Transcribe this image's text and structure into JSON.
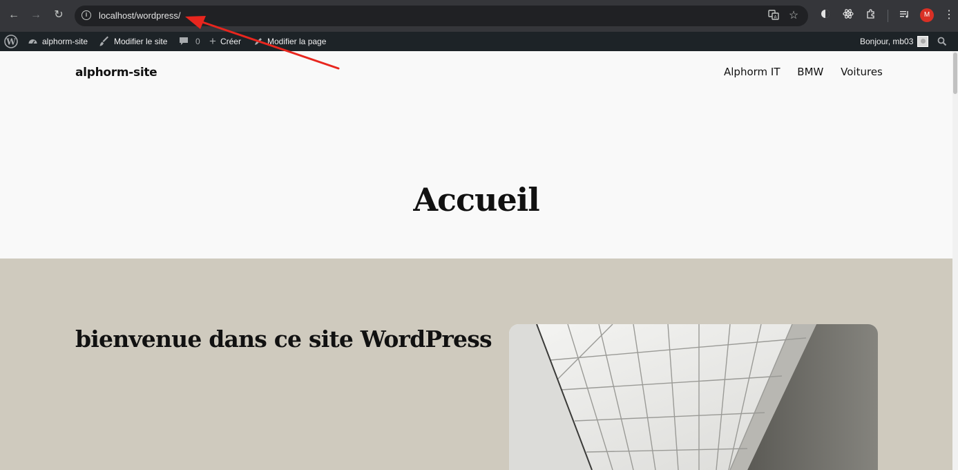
{
  "browser": {
    "url": "localhost/wordpress/",
    "profile_initial": "M",
    "icons": {
      "back": "arrow-left-icon",
      "forward": "arrow-right-icon",
      "reload": "reload-icon",
      "info": "info-icon",
      "translate": "translate-icon",
      "bookmark": "star-icon",
      "extensions": "puzzle-icon",
      "media": "media-controls-icon",
      "menu": "kebab-menu-icon"
    }
  },
  "adminbar": {
    "site_name": "alphorm-site",
    "edit_site": "Modifier le site",
    "comments_count": "0",
    "create": "Créer",
    "edit_page": "Modifier la page",
    "greeting": "Bonjour, mb03"
  },
  "site": {
    "title": "alphorm-site",
    "nav": [
      "Alphorm IT",
      "BMW",
      "Voitures"
    ]
  },
  "page": {
    "title": "Accueil",
    "welcome": "bienvenue dans ce site WordPress"
  },
  "colors": {
    "admin_bar": "#1d2327",
    "section_bg": "#cfcabe",
    "annotation": "#e8261e"
  }
}
